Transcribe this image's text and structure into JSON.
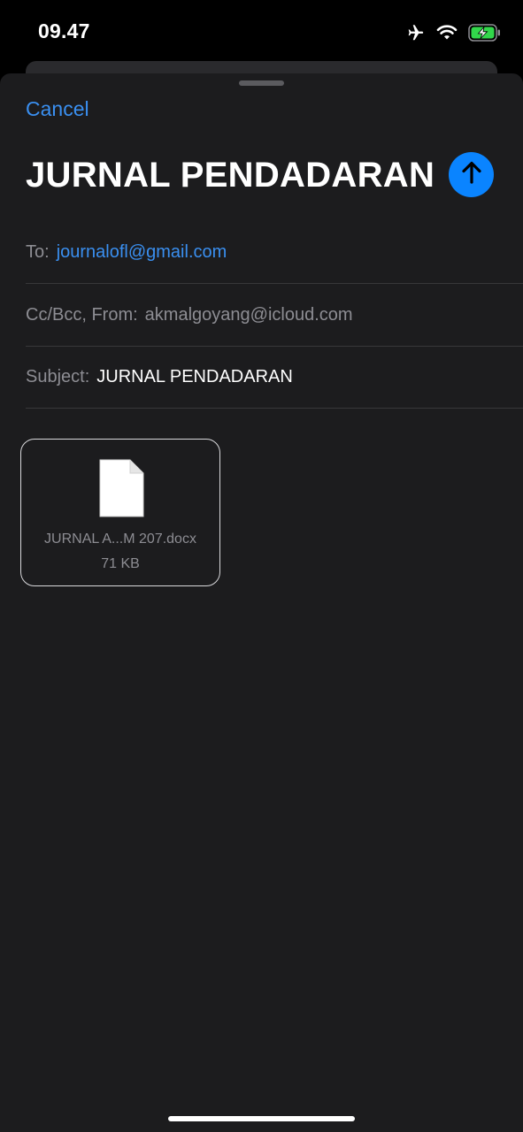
{
  "status_bar": {
    "time": "09.47",
    "icons": [
      "airplane-icon",
      "wifi-icon",
      "battery-charging-icon"
    ],
    "battery_color": "#32d74b"
  },
  "compose": {
    "cancel_label": "Cancel",
    "title": "JURNAL PENDADARAN",
    "send_icon": "arrow-up-icon",
    "accent_color": "#0a84ff"
  },
  "fields": {
    "to": {
      "label": "To:",
      "value": "journalofl@gmail.com"
    },
    "cc_bcc_from": {
      "label": "Cc/Bcc, From:",
      "value": "akmalgoyang@icloud.com"
    },
    "subject": {
      "label": "Subject:",
      "value": "JURNAL PENDADARAN"
    }
  },
  "attachment": {
    "icon": "document-icon",
    "name": "JURNAL A...M 207.docx",
    "size": "71 KB"
  }
}
